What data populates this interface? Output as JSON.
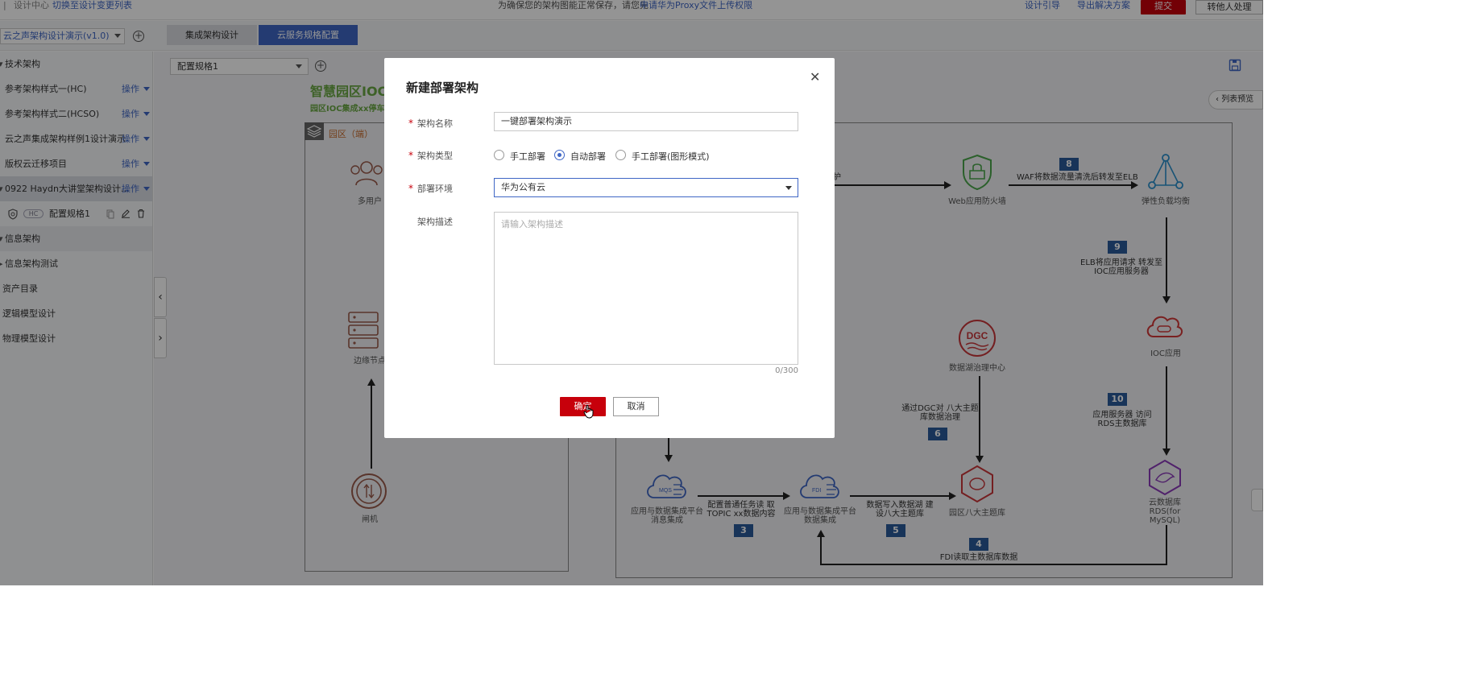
{
  "topbar": {
    "design_center": "设计中心",
    "switch_link": "切换至设计变更列表",
    "notice_prefix": "为确保您的架构图能正常保存，请您先",
    "notice_link": "申请华为Proxy文件上传权限",
    "design_guide": "设计引导",
    "export_solution": "导出解决方案",
    "submit": "提交",
    "transfer": "转他人处理"
  },
  "project": {
    "selected": "云之声架构设计演示(v1.0)",
    "tabs": [
      {
        "label": "集成架构设计",
        "active": false
      },
      {
        "label": "云服务规格配置",
        "active": true
      }
    ]
  },
  "sidebar": {
    "op_label": "操作",
    "items": [
      {
        "label": "技术架构",
        "op": false
      },
      {
        "label": "参考架构样式一(HC)",
        "op": true
      },
      {
        "label": "参考架构样式二(HCSO)",
        "op": true
      },
      {
        "label": "云之声集成架构样例1设计演示",
        "op": true
      },
      {
        "label": "版权云迁移项目",
        "op": true
      },
      {
        "label": "0922 Haydn大讲堂架构设计...",
        "op": true
      },
      {
        "label": "配置规格1",
        "badge": "HC",
        "child": true
      },
      {
        "label": "信息架构",
        "op": false
      },
      {
        "label": "信息架构测试",
        "op": false
      },
      {
        "label": "资产目录",
        "op": false
      },
      {
        "label": "逻辑模型设计",
        "op": false
      },
      {
        "label": "物理模型设计",
        "op": false
      }
    ]
  },
  "canvas": {
    "config_select": "配置规格1",
    "list_preview": "列表预览",
    "diagram_title": "智慧园区IOC",
    "diagram_subtitle": "园区IOC集成xx停车",
    "zone_label": "园区（端）",
    "nodes": {
      "users": "多用户",
      "edge": "边缘节点",
      "gate": "闸机",
      "waf": "Web应用防火墙",
      "elb": "弹性负载均衡",
      "ioc": "IOC应用",
      "dgc": "数据湖治理中心",
      "mqs": "应用与数据集成平台 消息集成",
      "fdi": "应用与数据集成平台 数据集成",
      "topic_db": "园区八大主题库",
      "rds": "云数据库 RDS(for MySQL)"
    },
    "edge_labels": {
      "protect": "护",
      "e8": "WAF将数据流量清洗后转发至ELB",
      "e9": "ELB将应用请求 转发至IOC应用服务器",
      "e10": "应用服务器 访问RDS主数据库",
      "e6": "通过DGC对 八大主题库数据治理",
      "e3": "配置普通任务读 取TOPIC xx数据内容",
      "e5": "数据写入数据湖 建设八大主题库",
      "e4": "FDI读取主数据库数据"
    },
    "numbers": [
      "8",
      "9",
      "10",
      "6",
      "3",
      "5",
      "4"
    ]
  },
  "modal": {
    "title": "新建部署架构",
    "name_label": "架构名称",
    "name_value": "一键部署架构演示",
    "type_label": "架构类型",
    "type_options": [
      "手工部署",
      "自动部署",
      "手工部署(图形模式)"
    ],
    "type_selected": "自动部署",
    "env_label": "部署环境",
    "env_value": "华为公有云",
    "desc_label": "架构描述",
    "desc_placeholder": "请输入架构描述",
    "counter": "0/300",
    "ok": "确定",
    "cancel": "取消"
  }
}
